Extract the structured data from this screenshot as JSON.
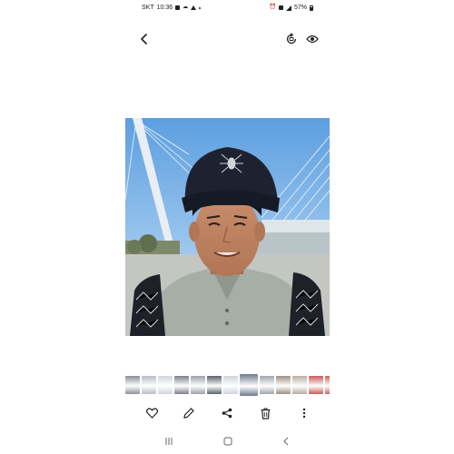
{
  "status_bar": {
    "carrier": "SKT",
    "time": "10:36",
    "battery": "57%",
    "left_icons": [
      "briefcase-icon",
      "cloud-icon",
      "warning-icon",
      "dot-icon"
    ],
    "right_icons": [
      "alarm-icon",
      "volte-icon",
      "signal-icon",
      "battery-icon"
    ]
  },
  "top_bar": {
    "icons": [
      "back-icon",
      "rotate-icon",
      "eye-icon"
    ]
  },
  "photo": {
    "subject": "selfie-photo"
  },
  "thumbnails": {
    "count": 16,
    "current_index": 7,
    "colors": [
      "#8a8f96",
      "#b6bcc4",
      "#d0d6dc",
      "#7c8088",
      "#9aa0a8",
      "#5a6068",
      "#cfd4da",
      "#6c7a8c",
      "#a1a5ab",
      "#9c8f82",
      "#b6ae9e",
      "#c9595a",
      "#c8655e",
      "#4e8fc9",
      "#c96a53",
      "#6ea0d0"
    ]
  },
  "actions": {
    "items": [
      "heart-icon",
      "edit-icon",
      "share-icon",
      "trash-icon",
      "more-icon"
    ]
  },
  "nav_bar": {
    "items": [
      "recents-icon",
      "home-icon",
      "back-nav-icon"
    ]
  },
  "colors": {
    "icon": "#222222",
    "nav_icon": "#666666",
    "sky": "#7fb3e6",
    "cap": "#1e2230",
    "shirt": "#a7aea6"
  }
}
